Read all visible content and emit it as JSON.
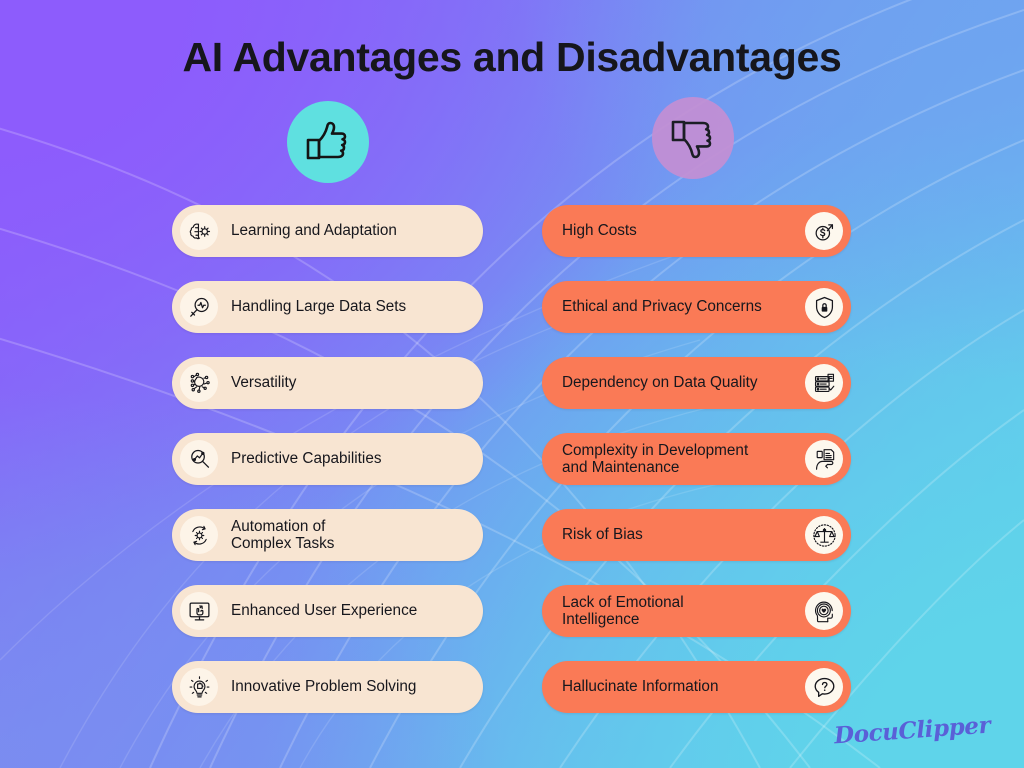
{
  "page": {
    "title": "AI Advantages and Disadvantages",
    "watermark": "DocuClipper"
  },
  "colors": {
    "bg_top_left": "#8a5cfb",
    "bg_top_right": "#6fa3f0",
    "bg_bottom_left": "#7b8ef0",
    "bg_bottom_right": "#5fd3ea",
    "pro_pill": "#f8e5d2",
    "con_pill": "#fa7a56",
    "badge_cream": "#fdf4e8",
    "thumb_up_circle": "#5fe0e0",
    "thumb_down_circle": "#c48fd4",
    "title_text": "#16161c"
  },
  "headers": {
    "advantages_icon": "thumbs-up-icon",
    "disadvantages_icon": "thumbs-down-icon"
  },
  "advantages": [
    {
      "label": "Learning and Adaptation",
      "icon": "brain-gear-icon"
    },
    {
      "label": "Handling Large Data Sets",
      "icon": "magnifier-pulse-icon"
    },
    {
      "label": "Versatility",
      "icon": "network-nodes-icon"
    },
    {
      "label": "Predictive Capabilities",
      "icon": "magnifier-chart-icon"
    },
    {
      "label": "Automation of\nComplex Tasks",
      "icon": "gear-cycle-icon"
    },
    {
      "label": "Enhanced User Experience",
      "icon": "screen-touch-icon"
    },
    {
      "label": "Innovative Problem Solving",
      "icon": "lightbulb-puzzle-icon"
    }
  ],
  "disadvantages": [
    {
      "label": "High Costs",
      "icon": "dollar-arrow-up-icon"
    },
    {
      "label": "Ethical and Privacy Concerns",
      "icon": "shield-lock-icon"
    },
    {
      "label": "Dependency on Data Quality",
      "icon": "data-checklist-icon"
    },
    {
      "label": "Complexity in Development\nand Maintenance",
      "icon": "document-hand-icon"
    },
    {
      "label": "Risk of Bias",
      "icon": "balance-scale-icon"
    },
    {
      "label": "Lack of Emotional\nIntelligence",
      "icon": "head-heart-icon"
    },
    {
      "label": "Hallucinate Information",
      "icon": "question-bubble-icon"
    }
  ]
}
